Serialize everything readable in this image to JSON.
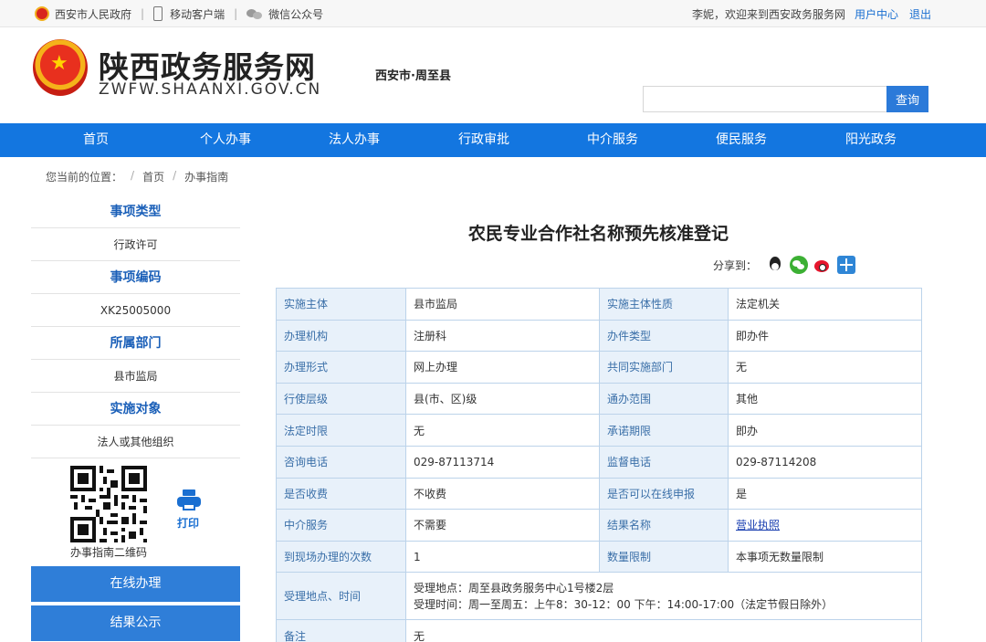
{
  "topbar": {
    "gov_link": "西安市人民政府",
    "mobile_link": "移动客户端",
    "wechat_link": "微信公众号",
    "welcome": "李妮，欢迎来到西安政务服务网",
    "user_center": "用户中心",
    "logout": "退出"
  },
  "header": {
    "logo_title": "陕西政务服务网",
    "logo_sub": "ZWFW.SHAANXI.GOV.CN",
    "region": "西安市·周至县",
    "search_placeholder": "",
    "search_button": "查询"
  },
  "nav": [
    "首页",
    "个人办事",
    "法人办事",
    "行政审批",
    "中介服务",
    "便民服务",
    "阳光政务"
  ],
  "breadcrumb": {
    "prefix": "您当前的位置：",
    "items": [
      "首页",
      "办事指南"
    ]
  },
  "sidebar": {
    "sections": [
      {
        "title": "事项类型",
        "value": "行政许可"
      },
      {
        "title": "事项编码",
        "value": "XK25005000"
      },
      {
        "title": "所属部门",
        "value": "县市监局"
      },
      {
        "title": "实施对象",
        "value": "法人或其他组织"
      }
    ],
    "qr_label": "办事指南二维码",
    "print_label": "打印",
    "buttons": [
      "在线办理",
      "结果公示"
    ]
  },
  "main": {
    "title": "农民专业合作社名称预先核准登记",
    "share_label": "分享到：",
    "rows": [
      [
        {
          "k": "实施主体",
          "v": "县市监局"
        },
        {
          "k": "实施主体性质",
          "v": "法定机关"
        }
      ],
      [
        {
          "k": "办理机构",
          "v": "注册科"
        },
        {
          "k": "办件类型",
          "v": "即办件"
        }
      ],
      [
        {
          "k": "办理形式",
          "v": "网上办理"
        },
        {
          "k": "共同实施部门",
          "v": "无"
        }
      ],
      [
        {
          "k": "行使层级",
          "v": "县(市、区)级"
        },
        {
          "k": "通办范围",
          "v": "其他"
        }
      ],
      [
        {
          "k": "法定时限",
          "v": "无"
        },
        {
          "k": "承诺期限",
          "v": "即办"
        }
      ],
      [
        {
          "k": "咨询电话",
          "v": "029-87113714"
        },
        {
          "k": "监督电话",
          "v": "029-87114208"
        }
      ],
      [
        {
          "k": "是否收费",
          "v": "不收费"
        },
        {
          "k": "是否可以在线申报",
          "v": "是"
        }
      ],
      [
        {
          "k": "中介服务",
          "v": "不需要"
        },
        {
          "k": "结果名称",
          "v": "营业执照"
        }
      ],
      [
        {
          "k": "到现场办理的次数",
          "v": "1"
        },
        {
          "k": "数量限制",
          "v": "本事项无数量限制"
        }
      ]
    ],
    "location_key": "受理地点、时间",
    "location_lines": [
      "受理地点：周至县政务服务中心1号楼2层",
      "受理时间：周一至周五：上午8：30-12：00 下午：14:00-17:00（法定节假日除外）"
    ],
    "remark_key": "备注",
    "remark_value": "无"
  }
}
